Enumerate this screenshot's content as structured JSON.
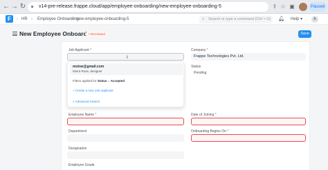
{
  "browser": {
    "url": "v14-pre-release.frappe.cloud/app/employee-onboarding/new-employee-onboarding-5",
    "paused_label": "Paused"
  },
  "navbar": {
    "breadcrumbs": [
      "HR",
      "Employee Onboarding",
      "new-employee-onboarding-5"
    ],
    "search_placeholder": "Search or type a command (Ctrl + G)",
    "help_label": "Help",
    "user_initial": "A"
  },
  "page": {
    "title": "New Employee Onboarding",
    "status_badge": "Not Saved",
    "save_label": "Save"
  },
  "form": {
    "job_applicant_label": "Job Applicant",
    "job_applicant_value": "",
    "company_label": "Company",
    "company_value": "Frappe Technologies Pvt. Ltd.",
    "status_label": "Status",
    "status_value": "Pending",
    "employee_name_label": "Employee Name",
    "date_of_joining_label": "Date of Joining",
    "department_label": "Department",
    "onboarding_begins_label": "Onboarding Begins On",
    "designation_label": "Designation",
    "employee_grade_label": "Employee Grade",
    "required_mark": "*"
  },
  "dropdown": {
    "item_email": "moirar@gmail.com",
    "item_subtitle": "Moira Rose, designer",
    "filter_prefix": "Filters applied for",
    "filter_field": "Status",
    "filter_eq": "=",
    "filter_value": "Accepted",
    "create_label": "Create a new Job Applicant",
    "advanced_label": "Advanced Search"
  }
}
